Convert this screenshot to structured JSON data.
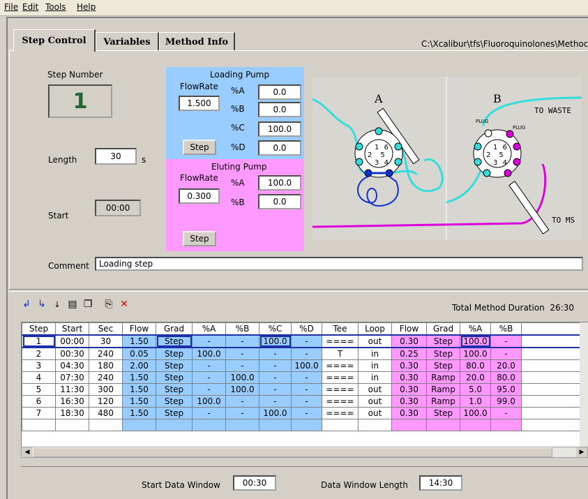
{
  "menu": {
    "file": "File",
    "edit": "Edit",
    "tools": "Tools",
    "help": "Help"
  },
  "tabs": {
    "step_control": "Step Control",
    "variables": "Variables",
    "method_info": "Method Info"
  },
  "path": "C:\\Xcalibur\\tfs\\Fluoroquinolones\\Methods",
  "step": {
    "number_label": "Step Number",
    "number": "1",
    "length_label": "Length",
    "length": "30",
    "length_unit": "s",
    "start_label": "Start",
    "start": "00:00",
    "comment_label": "Comment",
    "comment": "Loading step"
  },
  "loading_pump": {
    "title": "Loading Pump",
    "flowrate_label": "FlowRate",
    "flowrate": "1.500",
    "a_label": "%A",
    "a": "0.0",
    "b_label": "%B",
    "b": "0.0",
    "c_label": "%C",
    "c": "100.0",
    "d_label": "%D",
    "d": "0.0",
    "step_button": "Step"
  },
  "eluting_pump": {
    "title": "Eluting Pump",
    "flowrate_label": "FlowRate",
    "flowrate": "0.300",
    "a_label": "%A",
    "a": "100.0",
    "b_label": "%B",
    "b": "0.0",
    "step_button": "Step"
  },
  "diagram": {
    "valve_a": "A",
    "valve_b": "B",
    "to_waste": "TO WASTE",
    "to_ms": "TO MS",
    "plug1": "PLUG",
    "plug2": "PLUG",
    "ports": [
      "1",
      "6",
      "2",
      "5",
      "3",
      "4"
    ]
  },
  "total_duration_label": "Total Method Duration",
  "total_duration": "26:30",
  "table": {
    "headers": [
      "Step",
      "Start",
      "Sec",
      "Flow",
      "Grad",
      "%A",
      "%B",
      "%C",
      "%D",
      "Tee",
      "Loop",
      "Flow",
      "Grad",
      "%A",
      "%B"
    ],
    "rows": [
      [
        "1",
        "00:00",
        "30",
        "1.50",
        "Step",
        "-",
        "-",
        "100.0",
        "-",
        "====",
        "out",
        "0.30",
        "Step",
        "100.0",
        "-"
      ],
      [
        "2",
        "00:30",
        "240",
        "0.05",
        "Step",
        "100.0",
        "-",
        "-",
        "-",
        "T",
        "in",
        "0.25",
        "Step",
        "100.0",
        "-"
      ],
      [
        "3",
        "04:30",
        "180",
        "2.00",
        "Step",
        "-",
        "-",
        "-",
        "100.0",
        "====",
        "in",
        "0.30",
        "Step",
        "80.0",
        "20.0"
      ],
      [
        "4",
        "07:30",
        "240",
        "1.50",
        "Step",
        "-",
        "100.0",
        "-",
        "-",
        "====",
        "in",
        "0.30",
        "Ramp",
        "20.0",
        "80.0"
      ],
      [
        "5",
        "11:30",
        "300",
        "1.50",
        "Step",
        "-",
        "100.0",
        "-",
        "-",
        "====",
        "out",
        "0.30",
        "Ramp",
        "5.0",
        "95.0"
      ],
      [
        "6",
        "16:30",
        "120",
        "1.50",
        "Step",
        "100.0",
        "-",
        "-",
        "-",
        "====",
        "out",
        "0.30",
        "Ramp",
        "1.0",
        "99.0"
      ],
      [
        "7",
        "18:30",
        "480",
        "1.50",
        "Step",
        "-",
        "-",
        "100.0",
        "-",
        "====",
        "out",
        "0.30",
        "Step",
        "100.0",
        "-"
      ]
    ]
  },
  "footer": {
    "start_window_label": "Start Data Window",
    "start_window": "00:30",
    "window_length_label": "Data Window Length",
    "window_length": "14:30"
  },
  "colors": {
    "loading": "#99ccff",
    "eluting": "#ff99ff",
    "cyan": "#33dddd",
    "magenta": "#dd00dd",
    "blue_loop": "#1030cc"
  }
}
